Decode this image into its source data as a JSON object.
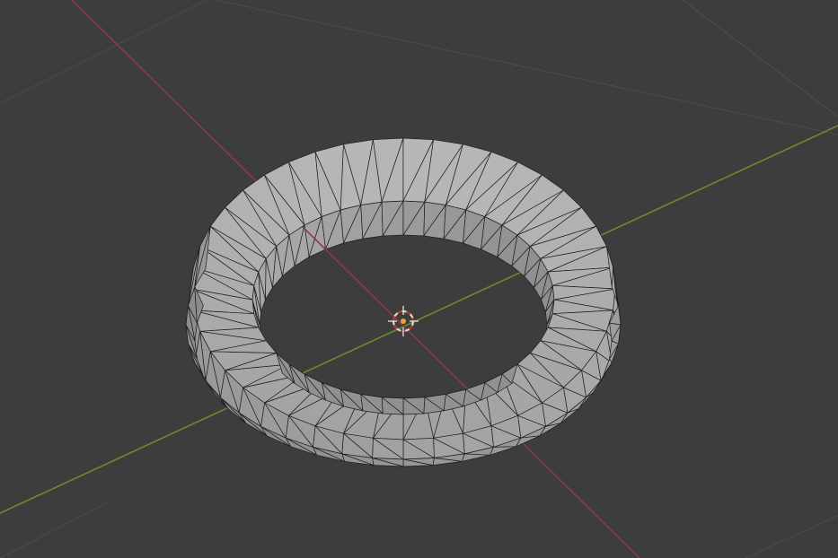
{
  "viewport": {
    "background": "#3d3d3d",
    "grid_color": "#4a4a4a",
    "x_axis_color": "#8a3a48",
    "y_axis_color": "#6c8a2e",
    "mesh_face_color": "#a9a9a9",
    "mesh_wire_color": "#1e1e1e",
    "cursor_colors": [
      "#d8d8d8",
      "#c0392b"
    ],
    "origin_color": "#f0a030"
  },
  "object": {
    "type": "ring-mesh",
    "shading": "solid",
    "wireframe_overlay": true
  },
  "icons": [
    "3d-cursor-icon",
    "origin-dot-icon"
  ]
}
